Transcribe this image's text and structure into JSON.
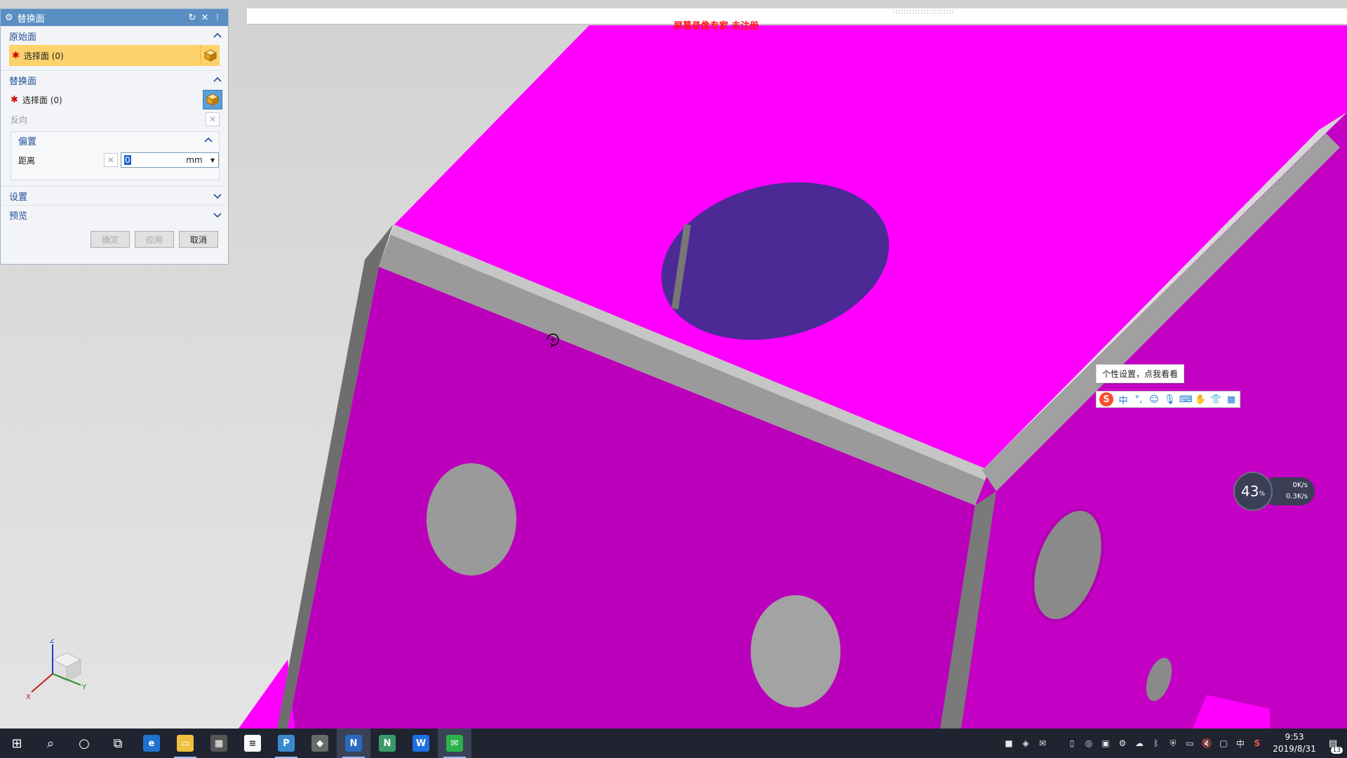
{
  "dialog": {
    "title": "替换面",
    "section_original": {
      "header": "原始面",
      "select_label": "选择面 (0)"
    },
    "section_replace": {
      "header": "替换面",
      "select_label": "选择面 (0)",
      "reverse_label": "反向"
    },
    "offset": {
      "header": "偏置",
      "distance_label": "距离",
      "distance_value": "0",
      "unit": "mm"
    },
    "section_settings": "设置",
    "section_preview": "预览",
    "buttons": {
      "ok": "确定",
      "apply": "应用",
      "cancel": "取消"
    }
  },
  "watermark": "屏幕录像专家 未注册",
  "ime": {
    "tooltip": "个性设置，点我看看",
    "lang": "中"
  },
  "speed_widget": {
    "percent": "43",
    "percent_unit": "%",
    "upload": "0K/s",
    "download": "0.3K/s"
  },
  "triad": {
    "z": "Z",
    "x": "X",
    "y": "Y"
  },
  "taskbar": {
    "apps": [
      "start-icon",
      "search-icon",
      "cortana-icon",
      "task-view-icon",
      "edge-icon",
      "file-explorer-icon",
      "calculator-icon",
      "notepad-icon",
      "app-p-icon",
      "app-car-icon",
      "nx-icon",
      "nx2-icon",
      "wps-icon",
      "wechat-icon"
    ],
    "tray_lang": "中",
    "time": "9:53",
    "date": "2019/8/31",
    "notifications": "13"
  },
  "colors": {
    "part_face": "#ff00ff",
    "part_side": "#b800b8",
    "hole": "#4b2a96",
    "fillet": "#8f8f8f",
    "title_bar": "#5a8fc4",
    "selection": "#fdd26b"
  }
}
